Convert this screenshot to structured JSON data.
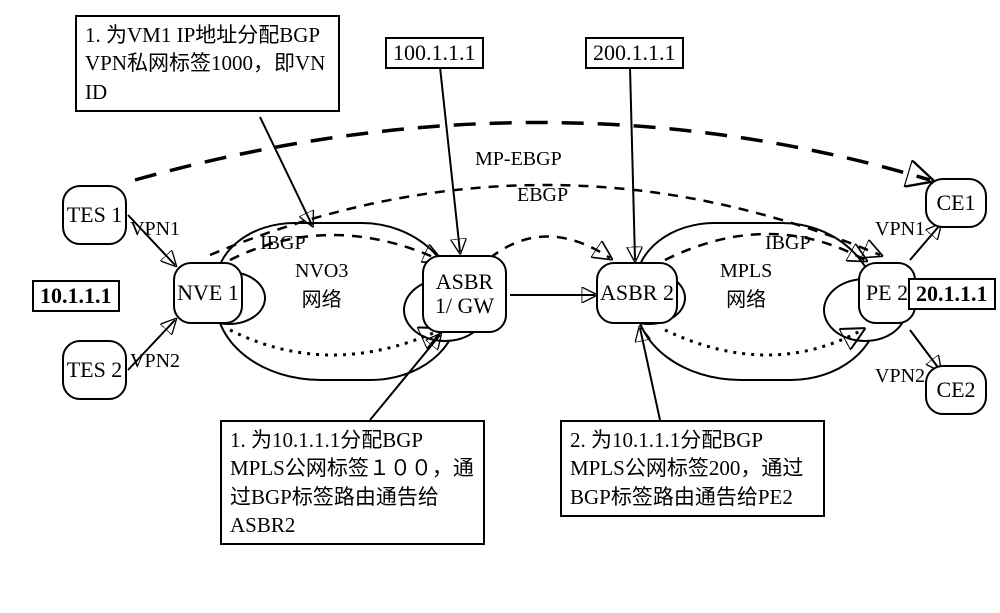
{
  "notes": {
    "note1": "1. 为VM1 IP地址分配BGP VPN私网标签1000，即VN ID",
    "note3": "1. 为10.1.1.1分配BGP MPLS公网标签１００，通过BGP标签路由通告给ASBR2",
    "note4": "2. 为10.1.1.1分配BGP MPLS公网标签200，通过BGP标签路由通告给PE2"
  },
  "ips": {
    "nve1": "10.1.1.1",
    "asbr1": "100.1.1.1",
    "asbr2": "200.1.1.1",
    "pe2": "20.1.1.1"
  },
  "labels": {
    "mp_ebgp": "MP-EBGP",
    "ebgp": "EBGP",
    "ibgp_left": "IBGP",
    "ibgp_right": "IBGP",
    "vpn1_left": "VPN1",
    "vpn2_left": "VPN2",
    "vpn1_right": "VPN1",
    "vpn2_right": "VPN2"
  },
  "clouds": {
    "nvo3": "NVO3\n网络",
    "mpls": "MPLS\n网络"
  },
  "nodes": {
    "tes1": "TES 1",
    "tes2": "TES 2",
    "nve1": "NVE 1",
    "asbr1": "ASBR 1/ GW",
    "asbr2": "ASBR 2",
    "pe2": "PE 2",
    "ce1": "CE1",
    "ce2": "CE2"
  }
}
